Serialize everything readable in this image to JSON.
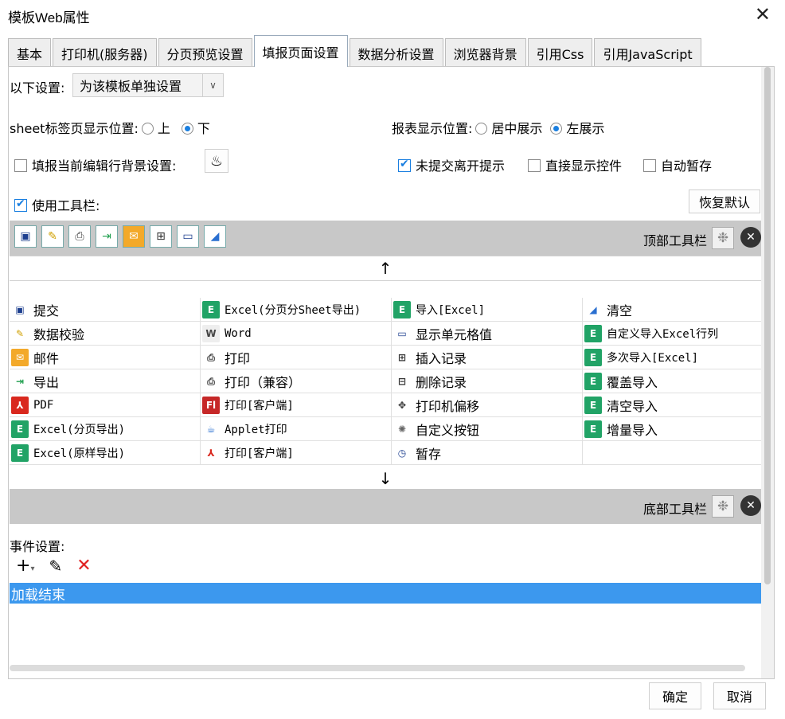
{
  "window": {
    "title": "模板Web属性",
    "close_glyph": "✕"
  },
  "tabs": [
    "基本",
    "打印机(服务器)",
    "分页预览设置",
    "填报页面设置",
    "数据分析设置",
    "浏览器背景",
    "引用Css",
    "引用JavaScript"
  ],
  "active_tab": "填报页面设置",
  "settings": {
    "scope_label": "以下设置:",
    "scope_value": "为该模板单独设置",
    "sheet_pos_label": "sheet标签页显示位置:",
    "sheet_pos_options": [
      "上",
      "下"
    ],
    "sheet_pos_selected": "下",
    "report_pos_label": "报表显示位置:",
    "report_pos_options": [
      "居中展示",
      "左展示"
    ],
    "report_pos_selected": "左展示",
    "row_bg_label": "填报当前编辑行背景设置:",
    "row_bg_checked": false,
    "unsubmitted_label": "未提交离开提示",
    "unsubmitted_checked": true,
    "direct_show_label": "直接显示控件",
    "direct_show_checked": false,
    "autosave_label": "自动暂存",
    "autosave_checked": false,
    "use_toolbar_label": "使用工具栏:",
    "use_toolbar_checked": true,
    "restore_label": "恢复默认"
  },
  "top_toolbar": {
    "label": "顶部工具栏",
    "icons": [
      "save-icon",
      "verify-icon",
      "print-icon",
      "export-icon",
      "mail-icon",
      "insert-row-icon",
      "cell-value-icon",
      "clear-icon"
    ]
  },
  "bottom_toolbar": {
    "label": "底部工具栏"
  },
  "up_arrow": "↑",
  "down_arrow": "↓",
  "buttons_grid": [
    [
      {
        "icon": "save-icon",
        "label": "提交"
      },
      {
        "icon": "excel-icon",
        "label": "Excel(分页分Sheet导出)"
      },
      {
        "icon": "excel-icon",
        "label": "导入[Excel]"
      },
      {
        "icon": "eraser-icon",
        "label": "清空"
      }
    ],
    [
      {
        "icon": "verify-icon",
        "label": "数据校验"
      },
      {
        "icon": "word-icon",
        "label": "Word"
      },
      {
        "icon": "cell-value-icon",
        "label": "显示单元格值"
      },
      {
        "icon": "excel-icon",
        "label": "自定义导入Excel行列"
      }
    ],
    [
      {
        "icon": "mail-icon",
        "label": "邮件"
      },
      {
        "icon": "print-icon",
        "label": "打印"
      },
      {
        "icon": "insert-row-icon",
        "label": "插入记录"
      },
      {
        "icon": "excel-icon",
        "label": "多次导入[Excel]"
      }
    ],
    [
      {
        "icon": "export-icon",
        "label": "导出"
      },
      {
        "icon": "print-icon",
        "label": "打印（兼容）"
      },
      {
        "icon": "delete-row-icon",
        "label": "删除记录"
      },
      {
        "icon": "excel-icon",
        "label": "覆盖导入"
      }
    ],
    [
      {
        "icon": "pdf-icon",
        "label": "PDF"
      },
      {
        "icon": "flash-print-icon",
        "label": "打印[客户端]"
      },
      {
        "icon": "move-icon",
        "label": "打印机偏移"
      },
      {
        "icon": "excel-icon",
        "label": "清空导入"
      }
    ],
    [
      {
        "icon": "excel-icon",
        "label": "Excel(分页导出)"
      },
      {
        "icon": "applet-icon",
        "label": "Applet打印"
      },
      {
        "icon": "gear-icon",
        "label": "自定义按钮"
      },
      {
        "icon": "excel-icon",
        "label": "增量导入"
      }
    ],
    [
      {
        "icon": "excel-icon",
        "label": "Excel(原样导出)"
      },
      {
        "icon": "pdf-print-icon",
        "label": "打印[客户端]"
      },
      {
        "icon": "temp-save-icon",
        "label": "暂存"
      },
      {
        "icon": "",
        "label": ""
      }
    ]
  ],
  "events": {
    "label": "事件设置:",
    "items": [
      "加载结束"
    ]
  },
  "footer": {
    "ok": "确定",
    "cancel": "取消"
  }
}
